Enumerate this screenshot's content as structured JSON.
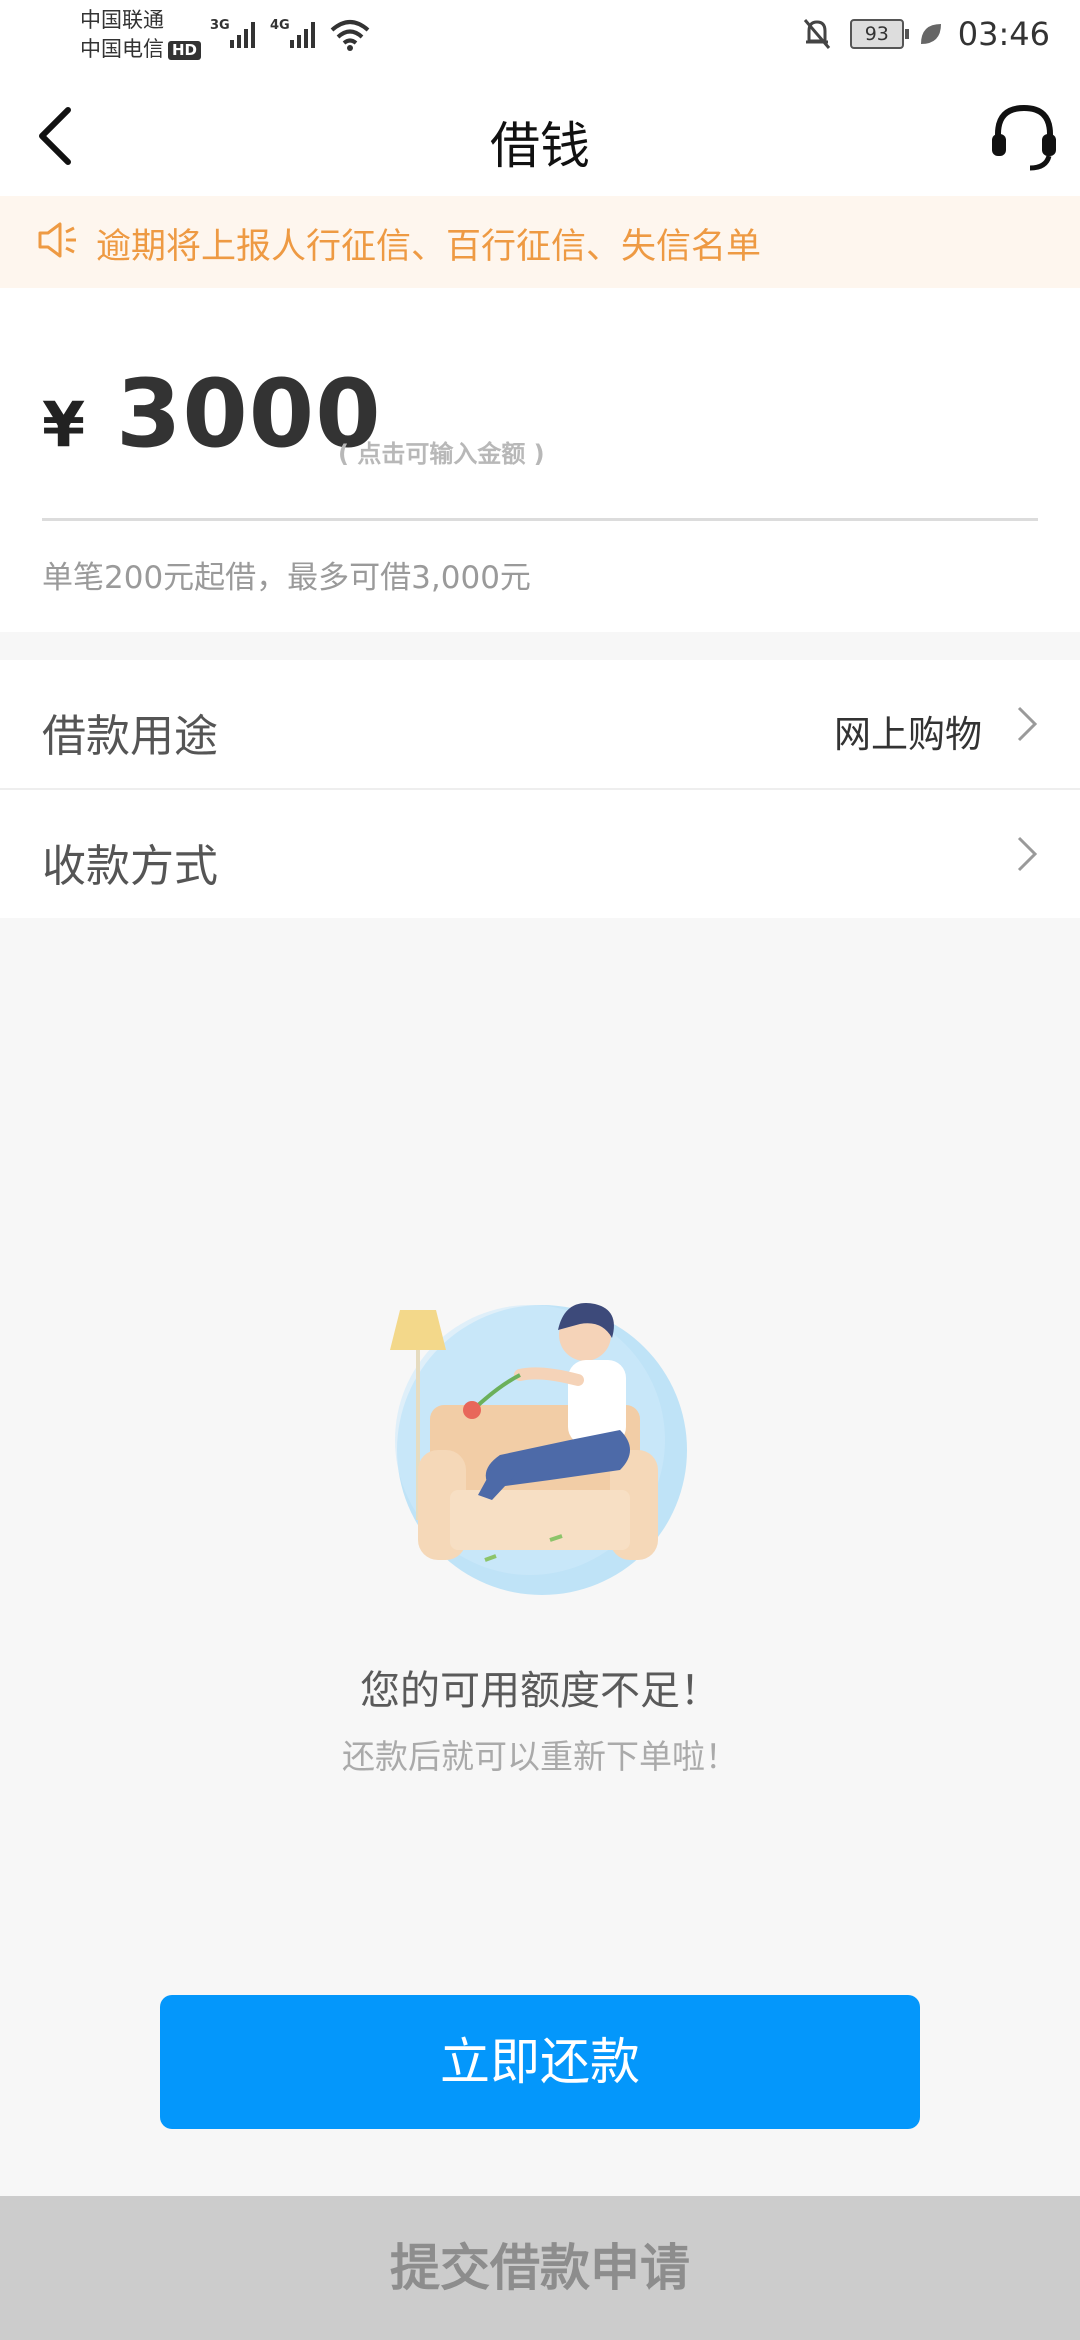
{
  "status_bar": {
    "carrier_1": "中国联通",
    "carrier_2": "中国电信",
    "hd_badge": "HD",
    "network_1": "3G",
    "network_2": "4G",
    "battery": "93",
    "time": "03:46"
  },
  "nav": {
    "title": "借钱",
    "back_icon": "back-arrow-icon",
    "support_icon": "headset-icon"
  },
  "notice": {
    "icon": "speaker-icon",
    "text": "逾期将上报人行征信、百行征信、失信名单"
  },
  "amount": {
    "currency": "¥",
    "value": "3000",
    "hint": "( 点击可输入金额 )",
    "rule": "单笔200元起借，最多可借3,000元"
  },
  "rows": [
    {
      "label": "借款用途",
      "value": "网上购物"
    },
    {
      "label": "收款方式",
      "value": ""
    }
  ],
  "empty_state": {
    "title": "您的可用额度不足！",
    "subtitle": "还款后就可以重新下单啦！"
  },
  "buttons": {
    "repay": "立即还款",
    "submit": "提交借款申请"
  },
  "colors": {
    "accent_blue": "#0497fb",
    "notice_orange": "#ee9a43",
    "notice_bg": "#fef6ee",
    "disabled_bar": "#cccccc"
  }
}
